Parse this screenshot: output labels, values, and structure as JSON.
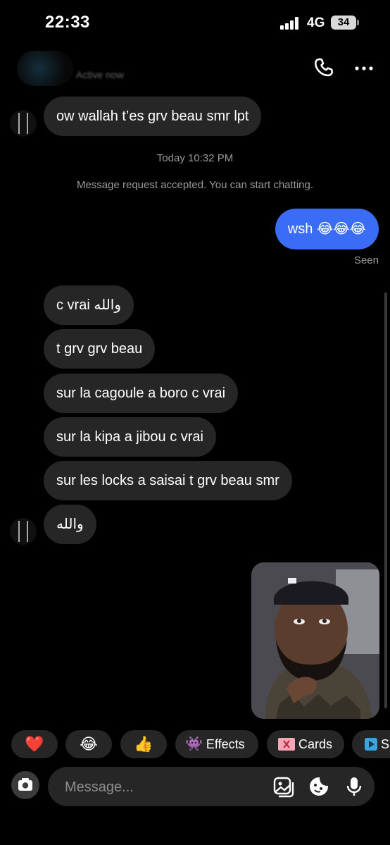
{
  "status_bar": {
    "time": "22:33",
    "network": "4G",
    "battery": "34"
  },
  "header": {
    "subtitle": "Active now",
    "icons": [
      "phone-icon",
      "more-icon"
    ]
  },
  "messages": {
    "first_incoming": "ow wallah t’es grv beau smr lpt",
    "timestamp": "Today 10:32 PM",
    "system_note": "Message request accepted. You can start chatting.",
    "outgoing": "wsh 😂😂😂",
    "seen": "Seen",
    "incoming": [
      "c vrai والله",
      "t grv grv beau",
      "sur la cagoule a boro c vrai",
      "sur la kipa a jibou c vrai",
      "sur les locks a saisai t grv beau smr",
      "والله"
    ]
  },
  "quick_reactions": {
    "heart": "❤️",
    "laugh": "😂",
    "thumbs": "👍",
    "effects": "Effects",
    "effects_emoji": "👾",
    "cards": "Cards",
    "more": "S"
  },
  "composer": {
    "placeholder": "Message..."
  },
  "colors": {
    "background": "#000000",
    "incoming_bubble": "#262626",
    "outgoing_bubble": "#3b6cf5"
  }
}
